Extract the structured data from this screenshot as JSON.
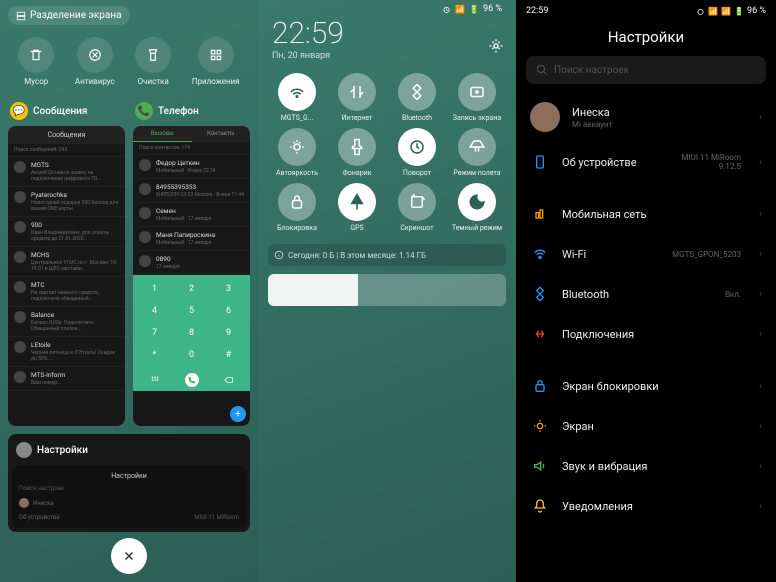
{
  "p1": {
    "split_label": "Разделение экрана",
    "tools": [
      {
        "label": "Мусор"
      },
      {
        "label": "Антивирус"
      },
      {
        "label": "Очистка"
      },
      {
        "label": "Приложения"
      }
    ],
    "card_messages": {
      "title": "Сообщения",
      "header": "Сообщения",
      "search": "Поиск сообщений: 245",
      "rows": [
        {
          "name": "MGTS",
          "preview": "Акция! Оставьте заявку на подключение цифрового ТВ..."
        },
        {
          "name": "Pyaterochka",
          "preview": "Новогодний подарок 500 баллов для вашей ONE карты"
        },
        {
          "name": "900",
          "preview": "Иван Владимирович, для оплаты кредита до 21.01.2020..."
        },
        {
          "name": "MCHS",
          "preview": "Центральное УГМС по г. Москве: 18-19.01 в ЦФО местами..."
        },
        {
          "name": "MTC",
          "preview": "Не хватает немного средств, подключите обещанный..."
        },
        {
          "name": "Balance",
          "preview": "Баланс 0,00р. Подключить Обещанный платеж..."
        },
        {
          "name": "LEtoile",
          "preview": "Черная пятница в Л'Этуаль! Скидки до 50%..."
        },
        {
          "name": "MTS-Inform",
          "preview": "Ваш номер..."
        }
      ]
    },
    "card_phone": {
      "title": "Телефон",
      "tabs": [
        "Вызовы",
        "Контакты"
      ],
      "search": "Поиск контактов: 174",
      "contacts": [
        {
          "name": "Федор Цеткин",
          "detail": "Мобильный · Вчера 22:34"
        },
        {
          "name": "84955395353",
          "detail": "8(495)539-53-53 Москва · Вчера 11:44"
        },
        {
          "name": "Семен",
          "detail": "Мобильный · 17 января"
        },
        {
          "name": "Маня Папироскина",
          "detail": "Мобильный · 17 января"
        },
        {
          "name": "0890",
          "detail": "17 января"
        }
      ],
      "keys": [
        "1",
        "2",
        "3",
        "4",
        "5",
        "6",
        "7",
        "8",
        "9",
        "*",
        "0",
        "#"
      ]
    },
    "card_settings": {
      "title": "Настройки",
      "search": "Поиск настроек",
      "account": "Инеска",
      "about": "Об устройстве",
      "about_val": "MIUI 11 MiRoom"
    }
  },
  "p2": {
    "time": "22:59",
    "date": "Пн, 20 января",
    "battery": "96 %",
    "qs": [
      {
        "label": "MGTS_G...",
        "on": true
      },
      {
        "label": "Интернет",
        "on": false
      },
      {
        "label": "Bluetooth",
        "on": false
      },
      {
        "label": "Запись экрана",
        "on": false
      },
      {
        "label": "Автояркость",
        "on": false
      },
      {
        "label": "Фонарик",
        "on": false
      },
      {
        "label": "Поворот",
        "on": true
      },
      {
        "label": "Режим полета",
        "on": false
      },
      {
        "label": "Блокировка",
        "on": false
      },
      {
        "label": "GPS",
        "on": true
      },
      {
        "label": "Скриншот",
        "on": false
      },
      {
        "label": "Темный режим",
        "on": true
      }
    ],
    "usage": "Сегодня: 0 Б | В этом месяце: 1.14 ГБ"
  },
  "p3": {
    "time": "22:59",
    "battery": "96 %",
    "title": "Настройки",
    "search": "Поиск настроек",
    "account": {
      "name": "Инеска",
      "sub": "Mi аккаунт"
    },
    "about": {
      "label": "Об устройстве",
      "val1": "MIUI 11 MiRoom",
      "val2": "9.12.5"
    },
    "rows": [
      {
        "label": "Мобильная сеть",
        "color": "#ff9800"
      },
      {
        "label": "Wi-Fi",
        "val": "MGTS_GPON_5203",
        "color": "#2196f3"
      },
      {
        "label": "Bluetooth",
        "val": "Вкл.",
        "color": "#2196f3"
      },
      {
        "label": "Подключения",
        "color": "#f44336"
      }
    ],
    "rows2": [
      {
        "label": "Экран блокировки",
        "color": "#2196f3"
      },
      {
        "label": "Экран",
        "color": "#ff9800"
      },
      {
        "label": "Звук и вибрация",
        "color": "#4caf50"
      },
      {
        "label": "Уведомления",
        "color": "#ffc107"
      }
    ]
  }
}
